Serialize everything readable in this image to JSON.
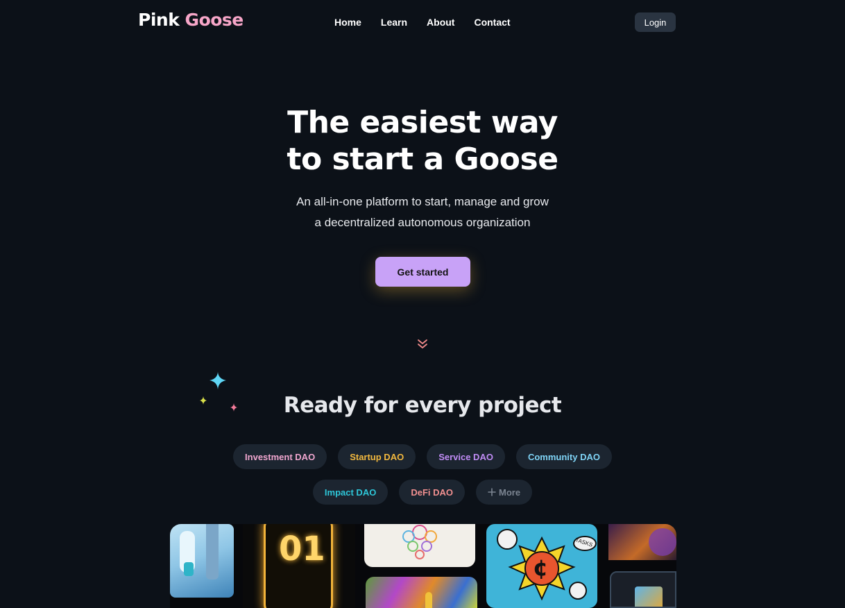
{
  "brand": {
    "part1": "Pink",
    "part2": "Goose",
    "accent": "#f7a6c8"
  },
  "nav": {
    "links": [
      "Home",
      "Learn",
      "About",
      "Contact"
    ],
    "login_label": "Login"
  },
  "hero": {
    "title_line1": "The easiest way",
    "title_line2": "to start a Goose",
    "subtitle_line1": "An all-in-one platform to start, manage and grow",
    "subtitle_line2": "a decentralized autonomous organization",
    "cta_label": "Get started",
    "cta_color": "#c8a2f7"
  },
  "scroll_icon": "double-chevron-down-icon",
  "projects": {
    "title": "Ready for every project",
    "tags_row1": [
      {
        "label": "Investment DAO",
        "color": "#f0a6cf"
      },
      {
        "label": "Startup DAO",
        "color": "#f2b83e"
      },
      {
        "label": "Service DAO",
        "color": "#c08cf5"
      },
      {
        "label": "Community DAO",
        "color": "#7fd3f5"
      }
    ],
    "tags_row2": [
      {
        "label": "Impact DAO",
        "color": "#2ec6d8"
      },
      {
        "label": "DeFi DAO",
        "color": "#f29090"
      },
      {
        "label": "More",
        "color": "#7c8592",
        "icon": "plus-icon"
      }
    ]
  },
  "gallery_texts": {
    "card_number": "01",
    "tasks": "TASKS",
    "coin_symbol": "¢"
  }
}
